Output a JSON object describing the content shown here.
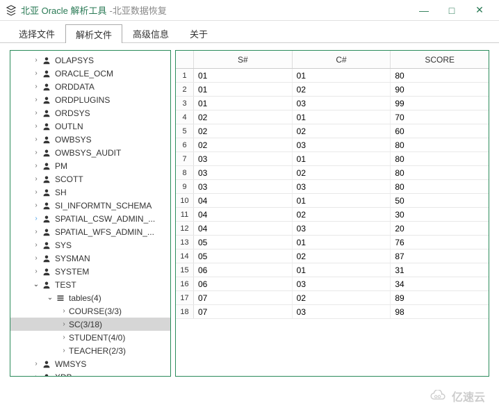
{
  "titlebar": {
    "title": "北亚 Oracle 解析工具",
    "subtitle": "-北亚数据恢复"
  },
  "tabs": [
    {
      "label": "选择文件",
      "active": false
    },
    {
      "label": "解析文件",
      "active": true
    },
    {
      "label": "高级信息",
      "active": false
    },
    {
      "label": "关于",
      "active": false
    }
  ],
  "tree": [
    {
      "label": "OLAPSYS",
      "indent": 1,
      "icon": "user",
      "chevron": ">"
    },
    {
      "label": "ORACLE_OCM",
      "indent": 1,
      "icon": "user",
      "chevron": ">"
    },
    {
      "label": "ORDDATA",
      "indent": 1,
      "icon": "user",
      "chevron": ">"
    },
    {
      "label": "ORDPLUGINS",
      "indent": 1,
      "icon": "user",
      "chevron": ">"
    },
    {
      "label": "ORDSYS",
      "indent": 1,
      "icon": "user",
      "chevron": ">"
    },
    {
      "label": "OUTLN",
      "indent": 1,
      "icon": "user",
      "chevron": ">"
    },
    {
      "label": "OWBSYS",
      "indent": 1,
      "icon": "user",
      "chevron": ">"
    },
    {
      "label": "OWBSYS_AUDIT",
      "indent": 1,
      "icon": "user",
      "chevron": ">"
    },
    {
      "label": "PM",
      "indent": 1,
      "icon": "user",
      "chevron": ">"
    },
    {
      "label": "SCOTT",
      "indent": 1,
      "icon": "user",
      "chevron": ">"
    },
    {
      "label": "SH",
      "indent": 1,
      "icon": "user",
      "chevron": ">"
    },
    {
      "label": "SI_INFORMTN_SCHEMA",
      "indent": 1,
      "icon": "user",
      "chevron": ">"
    },
    {
      "label": "SPATIAL_CSW_ADMIN_...",
      "indent": 1,
      "icon": "user",
      "chevron": ">",
      "chevronStyle": "blue"
    },
    {
      "label": "SPATIAL_WFS_ADMIN_...",
      "indent": 1,
      "icon": "user",
      "chevron": ">"
    },
    {
      "label": "SYS",
      "indent": 1,
      "icon": "user",
      "chevron": ">"
    },
    {
      "label": "SYSMAN",
      "indent": 1,
      "icon": "user",
      "chevron": ">"
    },
    {
      "label": "SYSTEM",
      "indent": 1,
      "icon": "user",
      "chevron": ">"
    },
    {
      "label": "TEST",
      "indent": 1,
      "icon": "user",
      "chevron": "v"
    },
    {
      "label": "tables(4)",
      "indent": 2,
      "icon": "bars",
      "chevron": "v"
    },
    {
      "label": "COURSE(3/3)",
      "indent": 3,
      "icon": "none",
      "chevron": ">"
    },
    {
      "label": "SC(3/18)",
      "indent": 3,
      "icon": "none",
      "chevron": ">",
      "selected": true
    },
    {
      "label": "STUDENT(4/0)",
      "indent": 3,
      "icon": "none",
      "chevron": ">"
    },
    {
      "label": "TEACHER(2/3)",
      "indent": 3,
      "icon": "none",
      "chevron": ">"
    },
    {
      "label": "WMSYS",
      "indent": 1,
      "icon": "user",
      "chevron": ">"
    },
    {
      "label": "XDB",
      "indent": 1,
      "icon": "user",
      "chevron": ">"
    }
  ],
  "grid": {
    "columns": [
      "S#",
      "C#",
      "SCORE"
    ],
    "rows": [
      [
        "01",
        "01",
        "80"
      ],
      [
        "01",
        "02",
        "90"
      ],
      [
        "01",
        "03",
        "99"
      ],
      [
        "02",
        "01",
        "70"
      ],
      [
        "02",
        "02",
        "60"
      ],
      [
        "02",
        "03",
        "80"
      ],
      [
        "03",
        "01",
        "80"
      ],
      [
        "03",
        "02",
        "80"
      ],
      [
        "03",
        "03",
        "80"
      ],
      [
        "04",
        "01",
        "50"
      ],
      [
        "04",
        "02",
        "30"
      ],
      [
        "04",
        "03",
        "20"
      ],
      [
        "05",
        "01",
        "76"
      ],
      [
        "05",
        "02",
        "87"
      ],
      [
        "06",
        "01",
        "31"
      ],
      [
        "06",
        "03",
        "34"
      ],
      [
        "07",
        "02",
        "89"
      ],
      [
        "07",
        "03",
        "98"
      ]
    ]
  },
  "watermark": "亿速云"
}
